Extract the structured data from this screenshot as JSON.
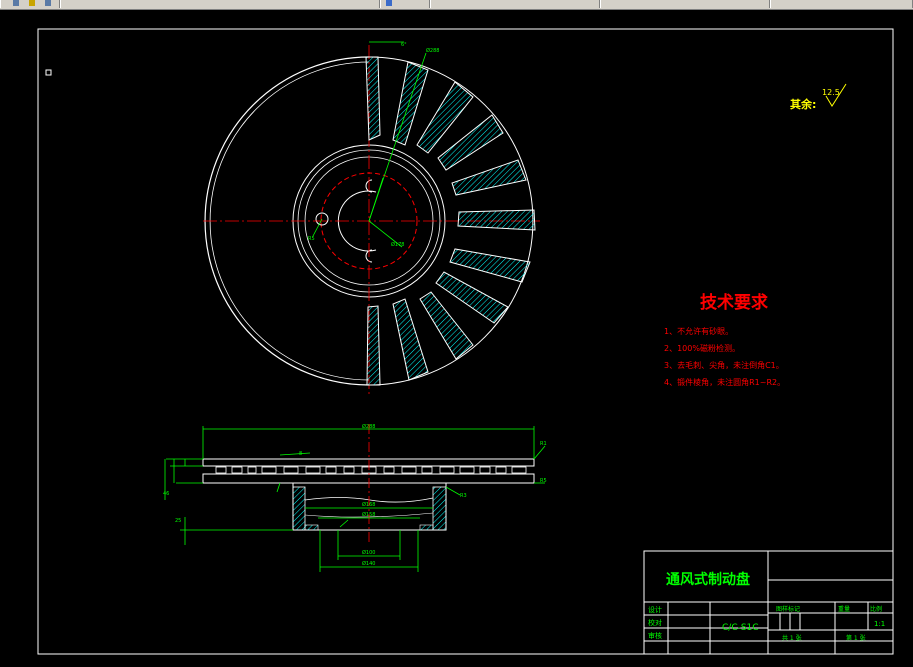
{
  "toolbar": {
    "items": [
      "tb-1",
      "tb-2",
      "tb-3",
      "tb-4",
      "tb-5",
      "tb-6"
    ]
  },
  "drawing": {
    "tech_title": "技术要求",
    "tech_items": [
      "1、不允许有砂眼。",
      "2、100%磁粉检测。",
      "3、去毛刺、尖角，未注倒角C1。",
      "4、锻件棱角，未注圆角R1~R2。"
    ],
    "roughness_label": "其余:",
    "roughness_value": "12.5",
    "front_dims": {
      "d_outer": "Ø288",
      "d_mid": "Ø178",
      "r_small": "R5",
      "angle": "6°"
    },
    "section_dims": {
      "width_top": "Ø288",
      "d1": "Ø168",
      "d2": "Ø158",
      "d3": "Ø100",
      "d4": "Ø140",
      "r1": "R1",
      "r2": "R5",
      "t1": "8",
      "t2": "25",
      "h1": "46",
      "r3": "R3"
    }
  },
  "title_block": {
    "name": "通风式制动盘",
    "drawing_no": "C/C-S1C",
    "row_labels": [
      "设计",
      "校对",
      "审核"
    ],
    "col_labels": [
      "图样标记",
      "重量",
      "比例"
    ],
    "scale": "1:1",
    "sheet_total": "共 1 张",
    "sheet_no": "第 1 张"
  },
  "colors": {
    "background": "#000000",
    "geometry": "#ffffff",
    "centerline": "#ff0000",
    "dimension": "#00ff00",
    "hatch": "#00ffff",
    "tech_text": "#ff0000",
    "title_text": "#00ff00",
    "roughness": "#ffff00"
  }
}
